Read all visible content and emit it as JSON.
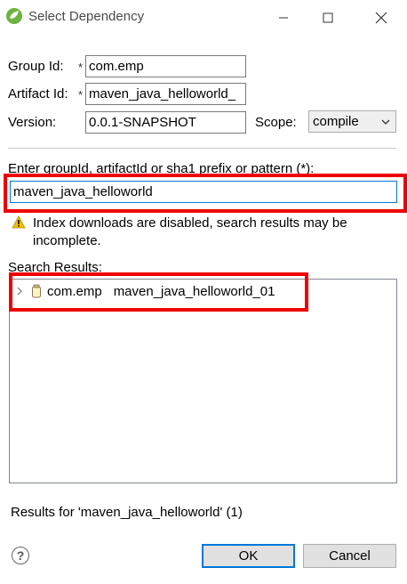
{
  "window": {
    "title": "Select Dependency",
    "minimize_icon": "minimize-icon",
    "maximize_icon": "maximize-icon",
    "close_icon": "close-icon"
  },
  "form": {
    "group_id_label": "Group Id:",
    "group_id_value": "com.emp",
    "artifact_id_label": "Artifact Id:",
    "artifact_id_value": "maven_java_helloworld_",
    "version_label": "Version:",
    "version_value": "0.0.1-SNAPSHOT",
    "scope_label": "Scope:",
    "scope_value": "compile",
    "required_mark": "*"
  },
  "search": {
    "label": "Enter groupId, artifactId or sha1 prefix or pattern (*):",
    "value": "maven_java_helloworld",
    "warning_text": "Index downloads are disabled, search results may be incomplete."
  },
  "results": {
    "label": "Search Results:",
    "items": [
      {
        "group": "com.emp",
        "artifact": "maven_java_helloworld_01"
      }
    ],
    "status": "Results for 'maven_java_helloworld' (1)"
  },
  "buttons": {
    "ok": "OK",
    "cancel": "Cancel",
    "help": "?"
  },
  "colors": {
    "highlight_red": "#ee0000",
    "focus_blue": "#0078d7",
    "warning_yellow": "#f2c200"
  }
}
